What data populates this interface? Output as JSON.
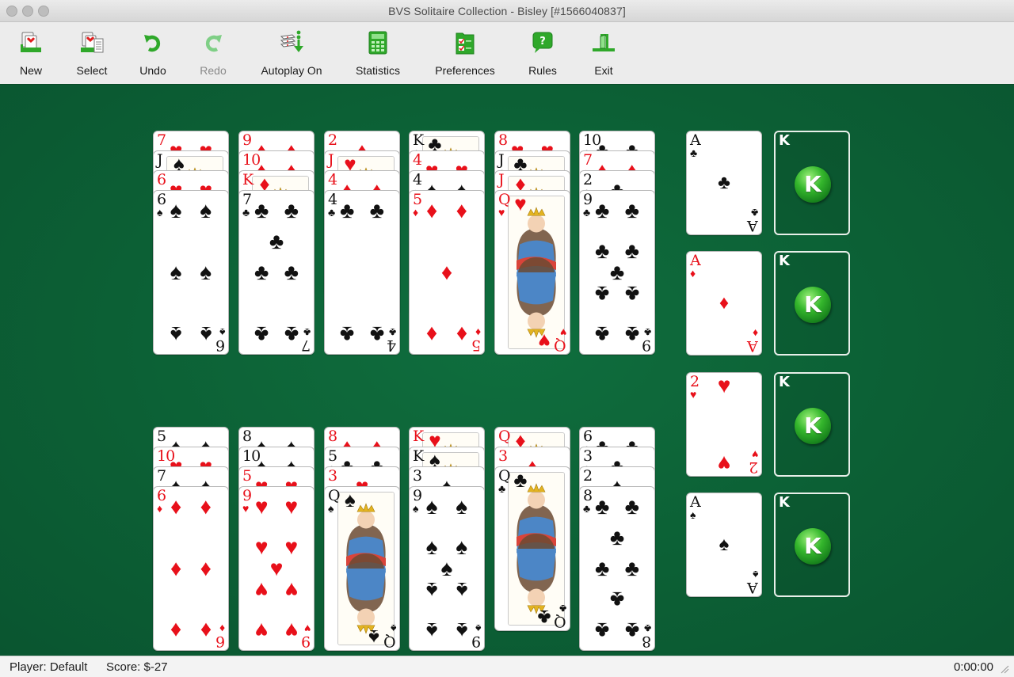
{
  "window": {
    "title": "BVS Solitaire Collection  -  Bisley [#1566040837]"
  },
  "toolbar": {
    "buttons": [
      {
        "id": "new",
        "label": "New",
        "icon": "new-game-icon",
        "enabled": true
      },
      {
        "id": "select",
        "label": "Select",
        "icon": "select-game-icon",
        "enabled": true
      },
      {
        "id": "undo",
        "label": "Undo",
        "icon": "undo-icon",
        "enabled": true
      },
      {
        "id": "redo",
        "label": "Redo",
        "icon": "redo-icon",
        "enabled": false
      },
      {
        "id": "autoplay",
        "label": "Autoplay On",
        "icon": "autoplay-icon",
        "enabled": true
      },
      {
        "id": "statistics",
        "label": "Statistics",
        "icon": "calculator-icon",
        "enabled": true
      },
      {
        "id": "preferences",
        "label": "Preferences",
        "icon": "checklist-icon",
        "enabled": true
      },
      {
        "id": "rules",
        "label": "Rules",
        "icon": "help-bubble-icon",
        "enabled": true
      },
      {
        "id": "exit",
        "label": "Exit",
        "icon": "exit-door-icon",
        "enabled": true
      }
    ]
  },
  "colors": {
    "felt": "#0c6035",
    "red_suit": "#e8101a",
    "black_suit": "#111111",
    "accent_green": "#2fa82a"
  },
  "tableau": {
    "top_row": [
      [
        "7♥",
        "J♠",
        "6♥",
        "6♠"
      ],
      [
        "9♦",
        "10♦",
        "K♦",
        "7♣"
      ],
      [
        "2♦",
        "J♥",
        "4♦",
        "4♣"
      ],
      [
        "K♣",
        "4♥",
        "4♠",
        "5♦"
      ],
      [
        "8♥",
        "J♣",
        "J♦",
        "Q♥"
      ],
      [
        "10♣",
        "7♦",
        "2♣",
        "9♣"
      ]
    ],
    "bottom_row": [
      [
        "5♠",
        "10♥",
        "7♠",
        "6♦"
      ],
      [
        "8♠",
        "10♠",
        "5♥",
        "9♥"
      ],
      [
        "8♦",
        "5♣",
        "3♥",
        "Q♠"
      ],
      [
        "K♥",
        "K♠",
        "3♠",
        "9♠"
      ],
      [
        "Q♦",
        "3♦",
        "Q♣"
      ],
      [
        "6♣",
        "3♣",
        "2♠",
        "8♣"
      ]
    ]
  },
  "foundations": {
    "ace_piles": [
      "A♣",
      "A♦",
      "2♥",
      "A♠"
    ],
    "king_piles": [
      {
        "label": "K",
        "badge": "K"
      },
      {
        "label": "K",
        "badge": "K"
      },
      {
        "label": "K",
        "badge": "K"
      },
      {
        "label": "K",
        "badge": "K"
      }
    ]
  },
  "status": {
    "player": "Player: Default",
    "score": "Score: $-27",
    "time": "0:00:00"
  }
}
